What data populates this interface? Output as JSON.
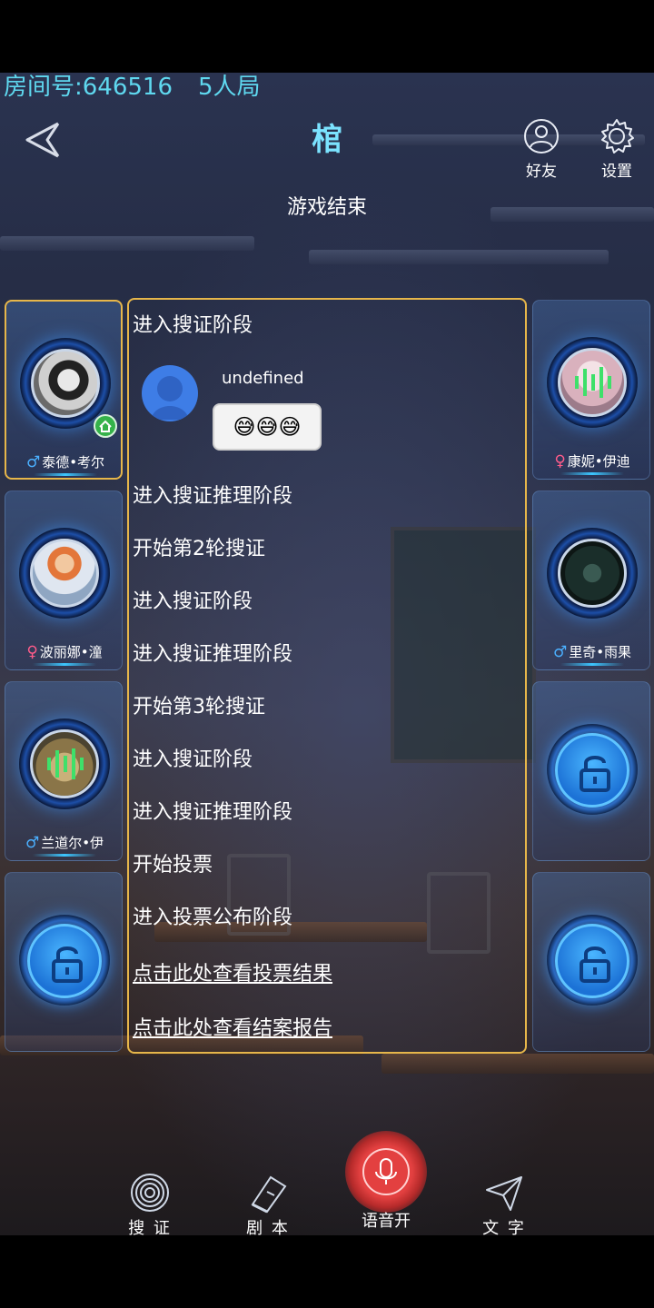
{
  "room": {
    "number_label": "房间号:646516",
    "player_count": "5人局"
  },
  "header": {
    "title": "棺",
    "subtitle": "游戏结束",
    "friends_label": "好友",
    "settings_label": "设置"
  },
  "left_slots": [
    {
      "name": "泰德•考尔",
      "gender": "♂",
      "active": true,
      "host": true
    },
    {
      "name": "波丽娜•潼",
      "gender": "♀"
    },
    {
      "name": "兰道尔•伊",
      "gender": "♂"
    },
    {
      "locked": true
    }
  ],
  "right_slots": [
    {
      "name": "康妮•伊迪",
      "gender": "♀"
    },
    {
      "name": "里奇•雨果",
      "gender": "♂"
    },
    {
      "locked": true
    },
    {
      "locked": true
    }
  ],
  "chat": {
    "messages": [
      "进入搜证阶段",
      "进入搜证推理阶段",
      "开始第2轮搜证",
      "进入搜证阶段",
      "进入搜证推理阶段",
      "开始第3轮搜证",
      "进入搜证阶段",
      "进入搜证推理阶段",
      "开始投票",
      "进入投票公布阶段"
    ],
    "user": {
      "name": "undefined",
      "emoji": "😅😅😅"
    },
    "links": [
      "点击此处查看投票结果",
      "点击此处查看结案报告"
    ]
  },
  "bottom_bar": {
    "evidence": "搜 证",
    "script": "剧 本",
    "voice": "语音开",
    "text": "文 字"
  },
  "colors": {
    "accent": "#5fd8ef",
    "frame": "#e6b64a",
    "mic": "#e34040"
  }
}
